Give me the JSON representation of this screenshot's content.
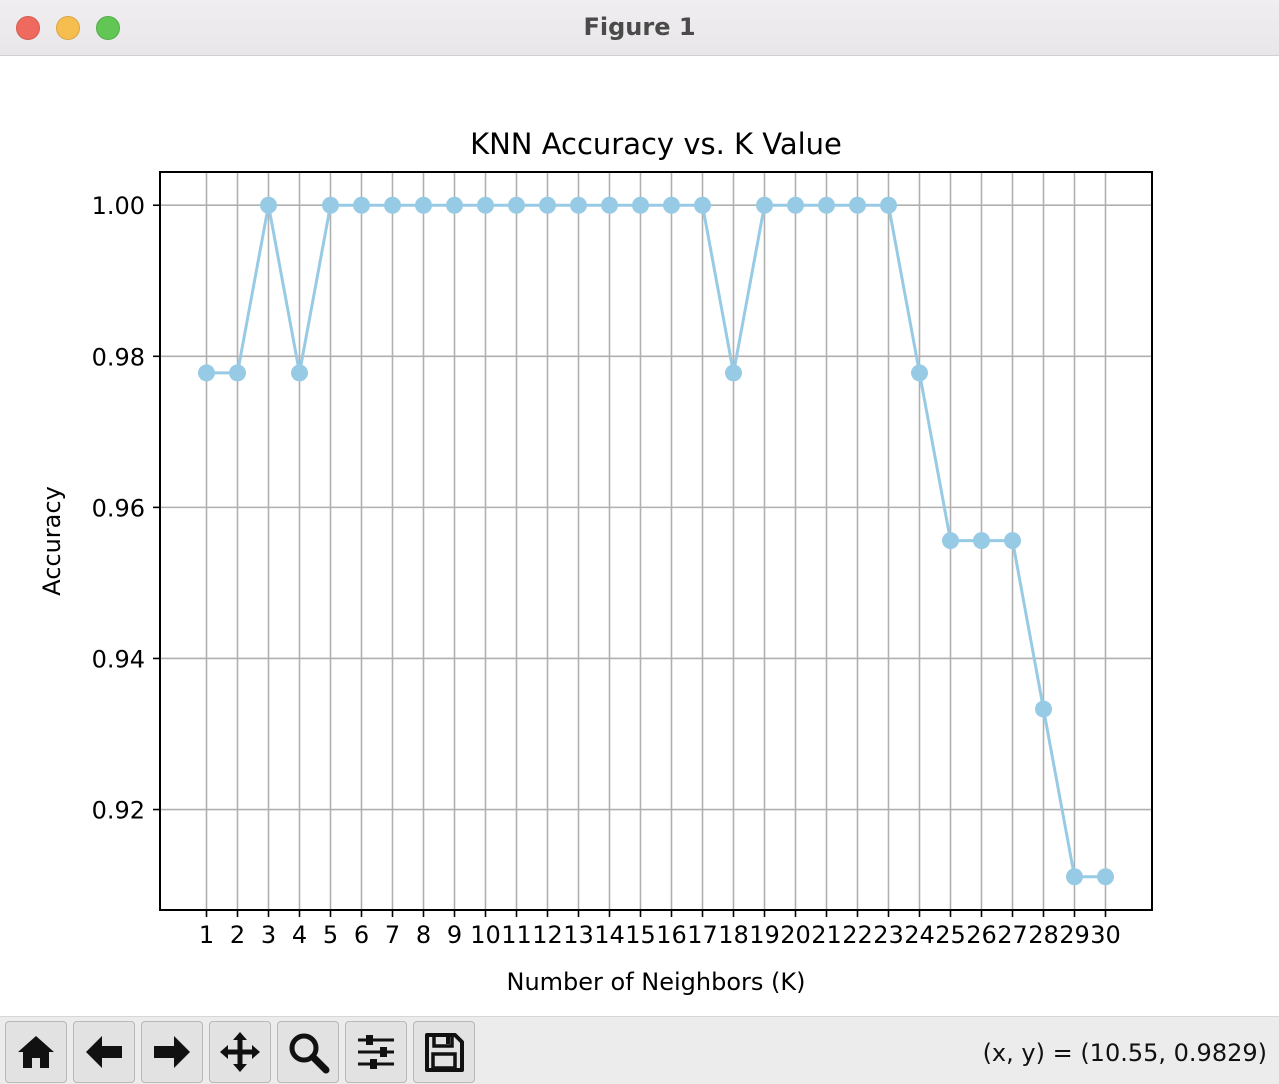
{
  "window": {
    "title": "Figure 1"
  },
  "status": {
    "coords": "(x, y) = (10.55, 0.9829)"
  },
  "toolbar": {
    "buttons": [
      {
        "name": "home-button",
        "icon": "home-icon"
      },
      {
        "name": "back-button",
        "icon": "arrow-left-icon"
      },
      {
        "name": "forward-button",
        "icon": "arrow-right-icon"
      },
      {
        "name": "pan-button",
        "icon": "move-icon"
      },
      {
        "name": "zoom-button",
        "icon": "magnifier-icon"
      },
      {
        "name": "configure-subplots-button",
        "icon": "sliders-icon"
      },
      {
        "name": "save-button",
        "icon": "floppy-disk-icon"
      }
    ]
  },
  "chart_data": {
    "type": "line",
    "title": "KNN Accuracy vs. K Value",
    "xlabel": "Number of Neighbors (K)",
    "ylabel": "Accuracy",
    "x": [
      1,
      2,
      3,
      4,
      5,
      6,
      7,
      8,
      9,
      10,
      11,
      12,
      13,
      14,
      15,
      16,
      17,
      18,
      19,
      20,
      21,
      22,
      23,
      24,
      25,
      26,
      27,
      28,
      29,
      30
    ],
    "series": [
      {
        "values": [
          0.9778,
          0.9778,
          1.0,
          0.9778,
          1.0,
          1.0,
          1.0,
          1.0,
          1.0,
          1.0,
          1.0,
          1.0,
          1.0,
          1.0,
          1.0,
          1.0,
          1.0,
          0.9778,
          1.0,
          1.0,
          1.0,
          1.0,
          1.0,
          0.9778,
          0.9556,
          0.9556,
          0.9556,
          0.9333,
          0.9111,
          0.9111
        ],
        "color": "#97cbe5",
        "marker": "circle"
      }
    ],
    "xticks": [
      "1",
      "2",
      "3",
      "4",
      "5",
      "6",
      "7",
      "8",
      "9",
      "10",
      "11",
      "12",
      "13",
      "14",
      "15",
      "16",
      "17",
      "18",
      "19",
      "20",
      "21",
      "22",
      "23",
      "24",
      "25",
      "26",
      "27",
      "28",
      "29",
      "30"
    ],
    "yticks": [
      "0.92",
      "0.94",
      "0.96",
      "0.98",
      "1.00"
    ],
    "ytick_values": [
      0.92,
      0.94,
      0.96,
      0.98,
      1.0
    ],
    "xlim": [
      -0.5,
      31.5
    ],
    "ylim": [
      0.9067,
      1.0044
    ],
    "grid": true
  }
}
